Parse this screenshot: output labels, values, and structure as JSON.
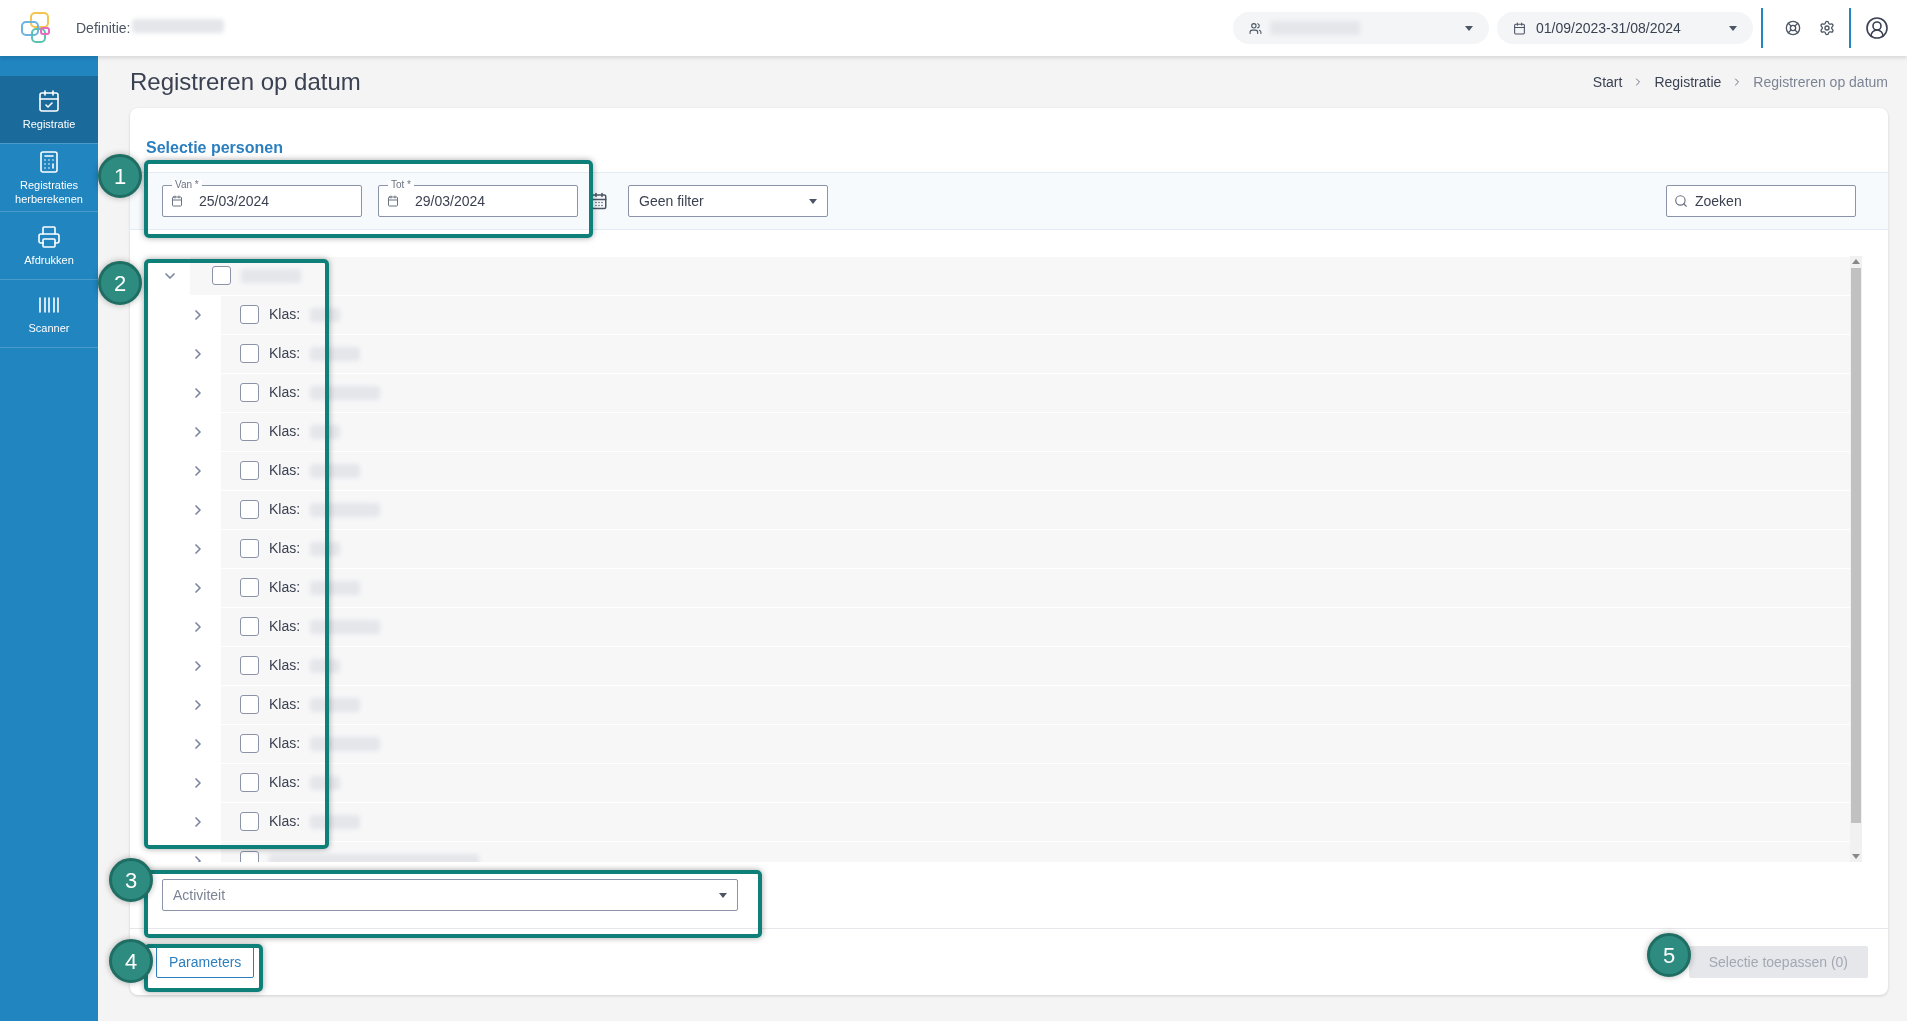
{
  "header": {
    "definition_label": "Definitie:",
    "period": "01/09/2023-31/08/2024"
  },
  "sidebar": {
    "items": [
      {
        "label": "Registratie",
        "selected": true
      },
      {
        "label": "Registraties herberekenen",
        "selected": false
      },
      {
        "label": "Afdrukken",
        "selected": false
      },
      {
        "label": "Scanner",
        "selected": false
      }
    ]
  },
  "page": {
    "title": "Registreren op datum",
    "breadcrumb": [
      "Start",
      "Registratie",
      "Registreren op datum"
    ]
  },
  "selection": {
    "title": "Selectie personen",
    "from": {
      "label": "Van *",
      "value": "25/03/2024"
    },
    "to": {
      "label": "Tot *",
      "value": "29/03/2024"
    },
    "filter": {
      "value": "Geen filter"
    },
    "search": {
      "placeholder": "Zoeken"
    }
  },
  "tree": [
    {
      "expanded": true,
      "checked": false,
      "children": [
        {
          "label": "Klas:",
          "expanded": false,
          "checked": false
        },
        {
          "label": "Klas:",
          "expanded": false,
          "checked": false
        },
        {
          "label": "Klas:",
          "expanded": false,
          "checked": false
        },
        {
          "label": "Klas:",
          "expanded": false,
          "checked": false
        },
        {
          "label": "Klas:",
          "expanded": false,
          "checked": false
        },
        {
          "label": "Klas:",
          "expanded": false,
          "checked": false
        },
        {
          "label": "Klas:",
          "expanded": false,
          "checked": false
        },
        {
          "label": "Klas:",
          "expanded": false,
          "checked": false
        },
        {
          "label": "Klas:",
          "expanded": false,
          "checked": false
        },
        {
          "label": "Klas:",
          "expanded": false,
          "checked": false
        },
        {
          "label": "Klas:",
          "expanded": false,
          "checked": false
        },
        {
          "label": "Klas:",
          "expanded": false,
          "checked": false
        },
        {
          "label": "Klas:",
          "expanded": false,
          "checked": false
        },
        {
          "label": "Klas:",
          "expanded": false,
          "checked": false
        },
        {
          "expanded": false,
          "checked": false
        }
      ]
    }
  ],
  "activity": {
    "placeholder": "Activiteit"
  },
  "buttons": {
    "parameters": "Parameters",
    "apply": {
      "label": "Selectie toepassen (0)",
      "disabled": true
    }
  },
  "annotations": [
    "1",
    "2",
    "3",
    "4",
    "5"
  ]
}
